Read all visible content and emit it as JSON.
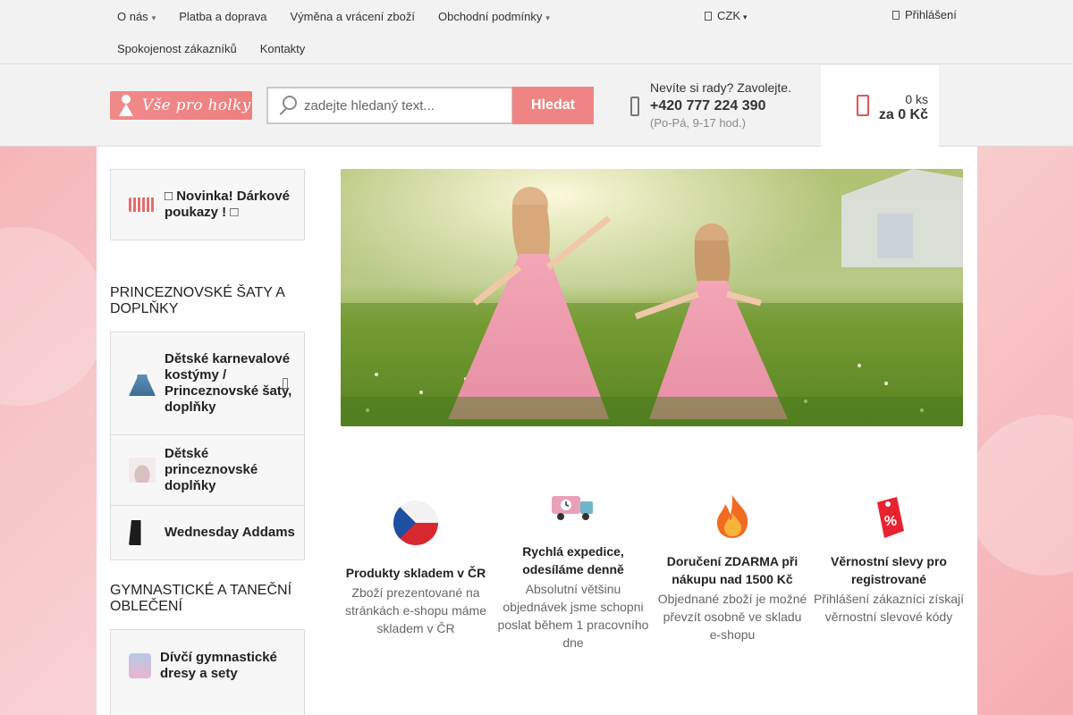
{
  "topnav": {
    "row1": [
      {
        "label": "O nás",
        "caret": true
      },
      {
        "label": "Platba a doprava",
        "caret": false
      },
      {
        "label": "Výměna a vrácení zboží",
        "caret": false
      },
      {
        "label": "Obchodní podmínky",
        "caret": true
      }
    ],
    "row2": [
      {
        "label": "Spokojenost zákazníků"
      },
      {
        "label": "Kontakty"
      }
    ],
    "currency": "CZK",
    "login": "Přihlášení"
  },
  "header": {
    "logo_text": "Vše pro holky",
    "search_placeholder": "zadejte hledaný text...",
    "search_button": "Hledat",
    "contact_question": "Nevíte si rady? Zavolejte.",
    "contact_phone": "+420 777 224 390",
    "contact_hours": "(Po-Pá, 9-17 hod.)",
    "cart_qty": "0 ks",
    "cart_total": "za 0 Kč"
  },
  "sidebar": {
    "promo": "□ Novinka! Dárkové poukazy ! □",
    "section1_title": "PRINCEZNOVSKÉ ŠATY A DOPLŇKY",
    "section1_items": [
      "Dětské karnevalové kostýmy / Princeznovské šaty, doplňky",
      "Dětské princeznovské doplňky",
      "Wednesday Addams"
    ],
    "section2_title": "GYMNASTICKÉ A TANEČNÍ OBLEČENÍ",
    "section2_items": [
      "Dívčí gymnastické dresy a sety"
    ]
  },
  "features": [
    {
      "title": "Produkty skladem v ČR",
      "desc": "Zboží prezentované na stránkách e-shopu máme skladem v ČR",
      "icon": "czech-flag-icon"
    },
    {
      "title": "Rychlá expedice, odesíláme denně",
      "desc": "Absolutní většinu objednávek jsme schopni poslat během 1 pracovního dne",
      "icon": "delivery-truck-icon"
    },
    {
      "title": "Doručení ZDARMA při nákupu nad 1500 Kč",
      "desc": "Objednané zboží je možné převzít osobně ve skladu e-shopu",
      "icon": "fire-icon"
    },
    {
      "title": "Věrnostní slevy pro registrované",
      "desc": "Přihlášení zákazníci získají věrnostní slevové kódy",
      "icon": "discount-tag-icon"
    }
  ],
  "colors": {
    "accent": "#ee8584",
    "cart_icon": "#e45454"
  }
}
